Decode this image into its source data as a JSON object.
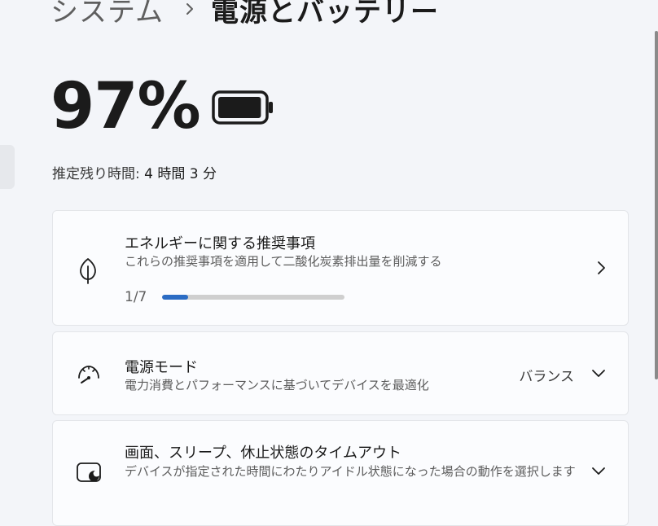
{
  "breadcrumb": {
    "parent": "システム",
    "current": "電源とバッテリー"
  },
  "battery": {
    "percent_label": "97%",
    "level": 0.97,
    "estimate_label": "推定残り時間:",
    "estimate_value": "4 時間 3 分"
  },
  "cards": {
    "energy": {
      "title": "エネルギーに関する推奨事項",
      "description": "これらの推奨事項を適用して二酸化炭素排出量を削減する",
      "progress_label": "1/7",
      "progress": 0.143,
      "icon": "leaf-icon"
    },
    "power_mode": {
      "title": "電源モード",
      "description": "電力消費とパフォーマンスに基づいてデバイスを最適化",
      "value": "バランス",
      "icon": "power-gauge-icon"
    },
    "screen_sleep": {
      "title": "画面、スリープ、休止状態のタイムアウト",
      "description": "デバイスが指定された時間にわたりアイドル状態になった場合の動作を選択します",
      "icon": "screen-sleep-icon"
    }
  },
  "colors": {
    "accent": "#2b6cc4",
    "background": "#f3f5f9",
    "card": "#fbfcfe"
  }
}
